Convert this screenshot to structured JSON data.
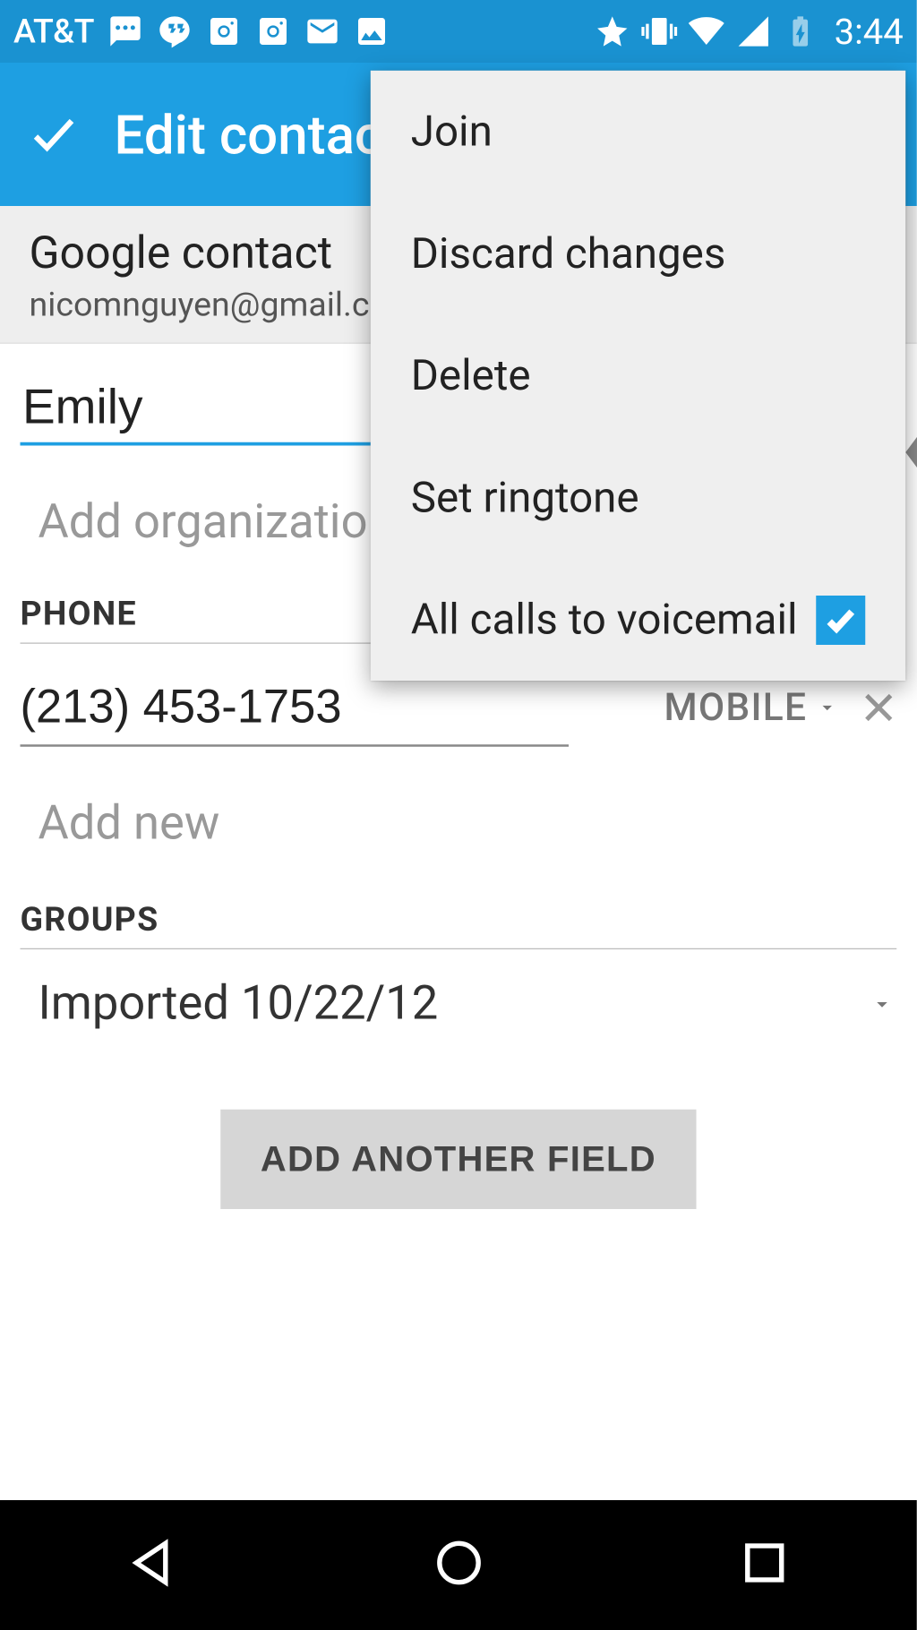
{
  "status": {
    "carrier": "AT&T",
    "clock": "3:44"
  },
  "appbar": {
    "title": "Edit contact"
  },
  "account": {
    "type": "Google contact",
    "email": "nicomnguyen@gmail.com"
  },
  "contact": {
    "name": "Emily",
    "add_org_placeholder": "Add organization"
  },
  "sections": {
    "phone_label": "PHONE",
    "groups_label": "GROUPS"
  },
  "phone": {
    "number": "(213) 453-1753",
    "type": "MOBILE",
    "add_new": "Add new"
  },
  "groups": {
    "value": "Imported 10/22/12"
  },
  "buttons": {
    "add_field": "ADD ANOTHER FIELD"
  },
  "menu": {
    "items": [
      {
        "label": "Join"
      },
      {
        "label": "Discard changes"
      },
      {
        "label": "Delete"
      },
      {
        "label": "Set ringtone"
      },
      {
        "label": "All calls to voicemail",
        "checked": true
      }
    ]
  }
}
